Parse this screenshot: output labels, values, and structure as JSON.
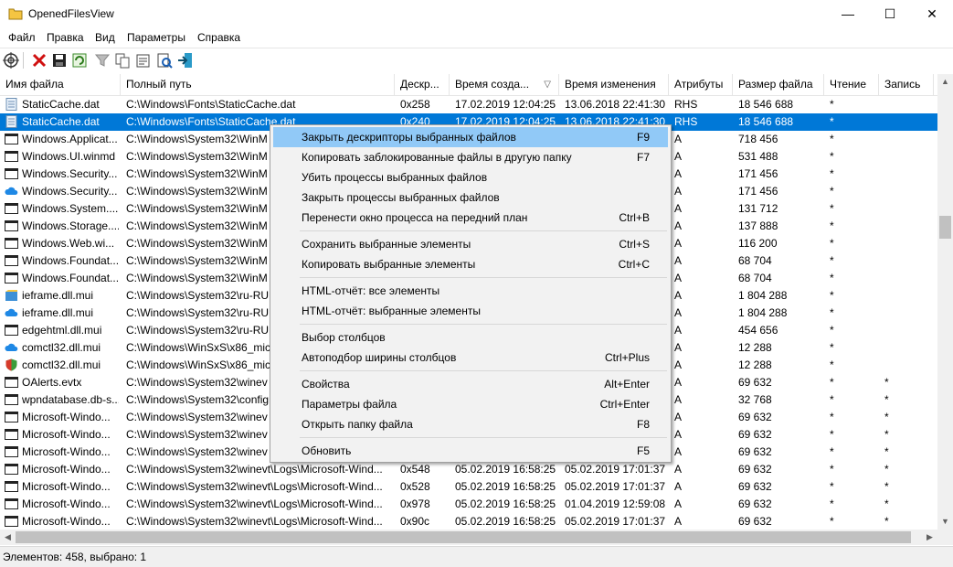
{
  "window": {
    "title": "OpenedFilesView",
    "minimize": "—",
    "maximize": "☐",
    "close": "✕"
  },
  "menu": [
    "Файл",
    "Правка",
    "Вид",
    "Параметры",
    "Справка"
  ],
  "columns": [
    {
      "label": "Имя файла"
    },
    {
      "label": "Полный путь"
    },
    {
      "label": "Дескр..."
    },
    {
      "label": "Время созда...",
      "sorted": true
    },
    {
      "label": "Время изменения"
    },
    {
      "label": "Атрибуты"
    },
    {
      "label": "Размер файла"
    },
    {
      "label": "Чтение"
    },
    {
      "label": "Запись"
    }
  ],
  "sort_arrow": "▽",
  "rows": [
    {
      "name": "StaticCache.dat",
      "path": "C:\\Windows\\Fonts\\StaticCache.dat",
      "handle": "0x258",
      "created": "17.02.2019 12:04:25",
      "modified": "13.06.2018 22:41:30",
      "attr": "RHS",
      "size": "18 546 688",
      "read": "*",
      "write": "",
      "icon": "dat-icon"
    },
    {
      "name": "StaticCache.dat",
      "path": "C:\\Windows\\Fonts\\StaticCache.dat",
      "handle": "0x240",
      "created": "17.02.2019 12:04:25",
      "modified": "13.06.2018 22:41:30",
      "attr": "RHS",
      "size": "18 546 688",
      "read": "*",
      "write": "",
      "icon": "dat-icon",
      "selected": true
    },
    {
      "name": "Windows.Applicat...",
      "path": "C:\\Windows\\System32\\WinM",
      "handle": "",
      "created": "",
      "modified": "",
      "attr": "A",
      "size": "718 456",
      "read": "*",
      "write": "",
      "icon": "window-icon"
    },
    {
      "name": "Windows.UI.winmd",
      "path": "C:\\Windows\\System32\\WinM",
      "handle": "",
      "created": "",
      "modified": "",
      "attr": "A",
      "size": "531 488",
      "read": "*",
      "write": "",
      "icon": "window-icon"
    },
    {
      "name": "Windows.Security...",
      "path": "C:\\Windows\\System32\\WinM",
      "handle": "",
      "created": "",
      "modified": "",
      "attr": "A",
      "size": "171 456",
      "read": "*",
      "write": "",
      "icon": "window-icon"
    },
    {
      "name": "Windows.Security...",
      "path": "C:\\Windows\\System32\\WinM",
      "handle": "",
      "created": "",
      "modified": "",
      "attr": "A",
      "size": "171 456",
      "read": "*",
      "write": "",
      "icon": "cloud-icon"
    },
    {
      "name": "Windows.System....",
      "path": "C:\\Windows\\System32\\WinM",
      "handle": "",
      "created": "",
      "modified": "",
      "attr": "A",
      "size": "131 712",
      "read": "*",
      "write": "",
      "icon": "window-icon"
    },
    {
      "name": "Windows.Storage....",
      "path": "C:\\Windows\\System32\\WinM",
      "handle": "",
      "created": "",
      "modified": "",
      "attr": "A",
      "size": "137 888",
      "read": "*",
      "write": "",
      "icon": "window-icon"
    },
    {
      "name": "Windows.Web.wi...",
      "path": "C:\\Windows\\System32\\WinM",
      "handle": "",
      "created": "",
      "modified": "",
      "attr": "A",
      "size": "116 200",
      "read": "*",
      "write": "",
      "icon": "window-icon"
    },
    {
      "name": "Windows.Foundat...",
      "path": "C:\\Windows\\System32\\WinM",
      "handle": "",
      "created": "",
      "modified": "",
      "attr": "A",
      "size": "68 704",
      "read": "*",
      "write": "",
      "icon": "window-icon"
    },
    {
      "name": "Windows.Foundat...",
      "path": "C:\\Windows\\System32\\WinM",
      "handle": "",
      "created": "",
      "modified": "",
      "attr": "A",
      "size": "68 704",
      "read": "*",
      "write": "",
      "icon": "window-icon"
    },
    {
      "name": "ieframe.dll.mui",
      "path": "C:\\Windows\\System32\\ru-RU",
      "handle": "",
      "created": "",
      "modified": "",
      "attr": "A",
      "size": "1 804 288",
      "read": "*",
      "write": "",
      "icon": "ie-icon"
    },
    {
      "name": "ieframe.dll.mui",
      "path": "C:\\Windows\\System32\\ru-RU",
      "handle": "",
      "created": "",
      "modified": "",
      "attr": "A",
      "size": "1 804 288",
      "read": "*",
      "write": "",
      "icon": "cloud-icon"
    },
    {
      "name": "edgehtml.dll.mui",
      "path": "C:\\Windows\\System32\\ru-RU",
      "handle": "",
      "created": "",
      "modified": "",
      "attr": "A",
      "size": "454 656",
      "read": "*",
      "write": "",
      "icon": "window-icon"
    },
    {
      "name": "comctl32.dll.mui",
      "path": "C:\\Windows\\WinSxS\\x86_mic",
      "handle": "",
      "created": "",
      "modified": "",
      "attr": "A",
      "size": "12 288",
      "read": "*",
      "write": "",
      "icon": "cloud-icon"
    },
    {
      "name": "comctl32.dll.mui",
      "path": "C:\\Windows\\WinSxS\\x86_mic",
      "handle": "",
      "created": "",
      "modified": "",
      "attr": "A",
      "size": "12 288",
      "read": "*",
      "write": "",
      "icon": "shield-icon"
    },
    {
      "name": "OAlerts.evtx",
      "path": "C:\\Windows\\System32\\winev",
      "handle": "",
      "created": "",
      "modified": "",
      "attr": "A",
      "size": "69 632",
      "read": "*",
      "write": "*",
      "icon": "window-icon"
    },
    {
      "name": "wpndatabase.db-s...",
      "path": "C:\\Windows\\System32\\config",
      "handle": "",
      "created": "",
      "modified": "",
      "attr": "A",
      "size": "32 768",
      "read": "*",
      "write": "*",
      "icon": "window-icon"
    },
    {
      "name": "Microsoft-Windo...",
      "path": "C:\\Windows\\System32\\winev",
      "handle": "",
      "created": "",
      "modified": "",
      "attr": "A",
      "size": "69 632",
      "read": "*",
      "write": "*",
      "icon": "window-icon"
    },
    {
      "name": "Microsoft-Windo...",
      "path": "C:\\Windows\\System32\\winev",
      "handle": "",
      "created": "",
      "modified": "",
      "attr": "A",
      "size": "69 632",
      "read": "*",
      "write": "*",
      "icon": "window-icon"
    },
    {
      "name": "Microsoft-Windo...",
      "path": "C:\\Windows\\System32\\winev",
      "handle": "",
      "created": "",
      "modified": "",
      "attr": "A",
      "size": "69 632",
      "read": "*",
      "write": "*",
      "icon": "window-icon"
    },
    {
      "name": "Microsoft-Windo...",
      "path": "C:\\Windows\\System32\\winevt\\Logs\\Microsoft-Wind...",
      "handle": "0x548",
      "created": "05.02.2019 16:58:25",
      "modified": "05.02.2019 17:01:37",
      "attr": "A",
      "size": "69 632",
      "read": "*",
      "write": "*",
      "icon": "window-icon"
    },
    {
      "name": "Microsoft-Windo...",
      "path": "C:\\Windows\\System32\\winevt\\Logs\\Microsoft-Wind...",
      "handle": "0x528",
      "created": "05.02.2019 16:58:25",
      "modified": "05.02.2019 17:01:37",
      "attr": "A",
      "size": "69 632",
      "read": "*",
      "write": "*",
      "icon": "window-icon"
    },
    {
      "name": "Microsoft-Windo...",
      "path": "C:\\Windows\\System32\\winevt\\Logs\\Microsoft-Wind...",
      "handle": "0x978",
      "created": "05.02.2019 16:58:25",
      "modified": "01.04.2019 12:59:08",
      "attr": "A",
      "size": "69 632",
      "read": "*",
      "write": "*",
      "icon": "window-icon"
    },
    {
      "name": "Microsoft-Windo...",
      "path": "C:\\Windows\\System32\\winevt\\Logs\\Microsoft-Wind...",
      "handle": "0x90c",
      "created": "05.02.2019 16:58:25",
      "modified": "05.02.2019 17:01:37",
      "attr": "A",
      "size": "69 632",
      "read": "*",
      "write": "*",
      "icon": "window-icon"
    }
  ],
  "context_menu": {
    "items": [
      {
        "label": "Закрыть дескрипторы выбранных файлов",
        "key": "F9",
        "highlighted": true
      },
      {
        "label": "Копировать заблокированные файлы в другую папку",
        "key": "F7"
      },
      {
        "label": "Убить процессы выбранных файлов",
        "key": ""
      },
      {
        "label": "Закрыть процессы выбранных файлов",
        "key": ""
      },
      {
        "label": "Перенести окно процесса на передний план",
        "key": "Ctrl+B"
      },
      {
        "separator": true
      },
      {
        "label": "Сохранить выбранные элементы",
        "key": "Ctrl+S"
      },
      {
        "label": "Копировать выбранные элементы",
        "key": "Ctrl+C"
      },
      {
        "separator": true
      },
      {
        "label": "HTML-отчёт: все элементы",
        "key": ""
      },
      {
        "label": "HTML-отчёт: выбранные элементы",
        "key": ""
      },
      {
        "separator": true
      },
      {
        "label": "Выбор столбцов",
        "key": ""
      },
      {
        "label": "Автоподбор ширины столбцов",
        "key": "Ctrl+Plus"
      },
      {
        "separator": true
      },
      {
        "label": "Свойства",
        "key": "Alt+Enter"
      },
      {
        "label": "Параметры файла",
        "key": "Ctrl+Enter"
      },
      {
        "label": "Открыть папку файла",
        "key": "F8"
      },
      {
        "separator": true
      },
      {
        "label": "Обновить",
        "key": "F5"
      }
    ]
  },
  "status": "Элементов: 458, выбрано: 1",
  "colors": {
    "selection": "#0078d7",
    "menu_highlight": "#91c9f7",
    "menu_bg": "#f2f2f2"
  }
}
